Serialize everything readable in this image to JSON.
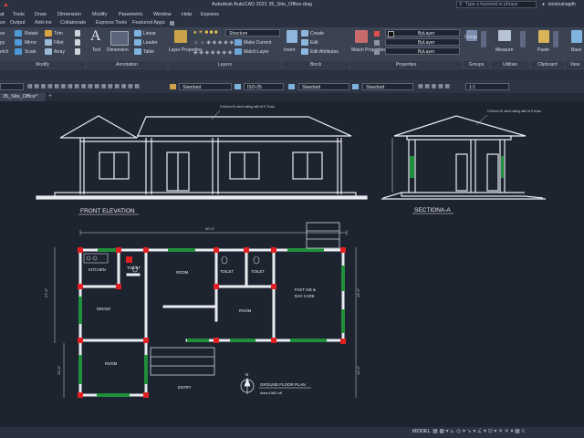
{
  "titlebar": {
    "title": "Autodesk AutoCAD 2021   35_Site_Office.dwg",
    "search_placeholder": "Type a keyword or phrase",
    "user": "krishnahagith"
  },
  "menubar": {
    "items": [
      "at",
      "Tools",
      "Draw",
      "Dimension",
      "Modify",
      "Parametric",
      "Window",
      "Help",
      "Express"
    ]
  },
  "ribbon_tabs": {
    "items": [
      "ze",
      "Output",
      "Add-ins",
      "Collaborate",
      "Express Tools",
      "Featured Apps"
    ]
  },
  "ribbon": {
    "modify": {
      "title": "Modify",
      "items": [
        "Rotate",
        "Trim",
        "Mirror",
        "Fillet",
        "Scale",
        "Array",
        "ve",
        "py",
        "etch"
      ]
    },
    "annotation": {
      "title": "Annotation",
      "text": "Text",
      "dimension": "Dimension",
      "linear": "Linear",
      "leader": "Leader",
      "table": "Table"
    },
    "layers": {
      "title": "Layers",
      "properties": "Layer Properties",
      "current_layer": "Structure",
      "make_current": "Make Current",
      "match_layer": "Match Layer"
    },
    "block": {
      "title": "Block",
      "insert": "Insert",
      "create": "Create",
      "edit": "Edit",
      "edit_attributes": "Edit Attributes"
    },
    "properties": {
      "title": "Properties",
      "match": "Match Properties",
      "color": "ByLayer",
      "linetype": "ByLayer",
      "lineweight": "ByLayer"
    },
    "groups": {
      "title": "Groups",
      "group": "Group"
    },
    "utilities": {
      "title": "Utilities",
      "measure": "Measure"
    },
    "clipboard": {
      "title": "Clipboard",
      "paste": "Paste"
    },
    "view": {
      "title": "View",
      "base": "Base"
    }
  },
  "property_bar": {
    "text_style": "Standard",
    "dim_style": "ISO-25",
    "table_style": "Standard",
    "multileader_style": "Standard",
    "scale": "1:1"
  },
  "file_tab": {
    "name": "35_Site_Office*"
  },
  "drawing": {
    "front_elevation": "FRONT ELEVATION",
    "section": "SECTIONA-A",
    "ground_floor_plan": "GROUND FLOOR PLAN",
    "area": "Area:1962 sft",
    "entry": "ENTRY",
    "north": "N",
    "note_elevation": "0.60mm Dr steel railing with M S Truss",
    "note_section": "0.60mm Dr steel railing with M S truss",
    "dim_top": "40'-0\"",
    "dim_left": "27'-6\"",
    "dim_left_lower": "13'-0\"",
    "dim_right": "13'-6\"",
    "dim_right_lower": "13'-0\"",
    "rooms": {
      "kitchen": "KITCHEN",
      "toilet1": "TOILET",
      "room1": "ROOM",
      "toilet2": "TOILET",
      "toilet3": "TOILET",
      "fast_aid": "FAST AID &",
      "day_care": "DAY CARE",
      "dining": "DINING",
      "room2": "ROOM",
      "room3": "ROOM"
    }
  },
  "statusbar": {
    "model": "MODEL"
  },
  "colors": {
    "canvas": "#1e2330",
    "ribbon": "#3b4252",
    "wall_green": "#1f8f3a",
    "column_red": "#e02020"
  }
}
